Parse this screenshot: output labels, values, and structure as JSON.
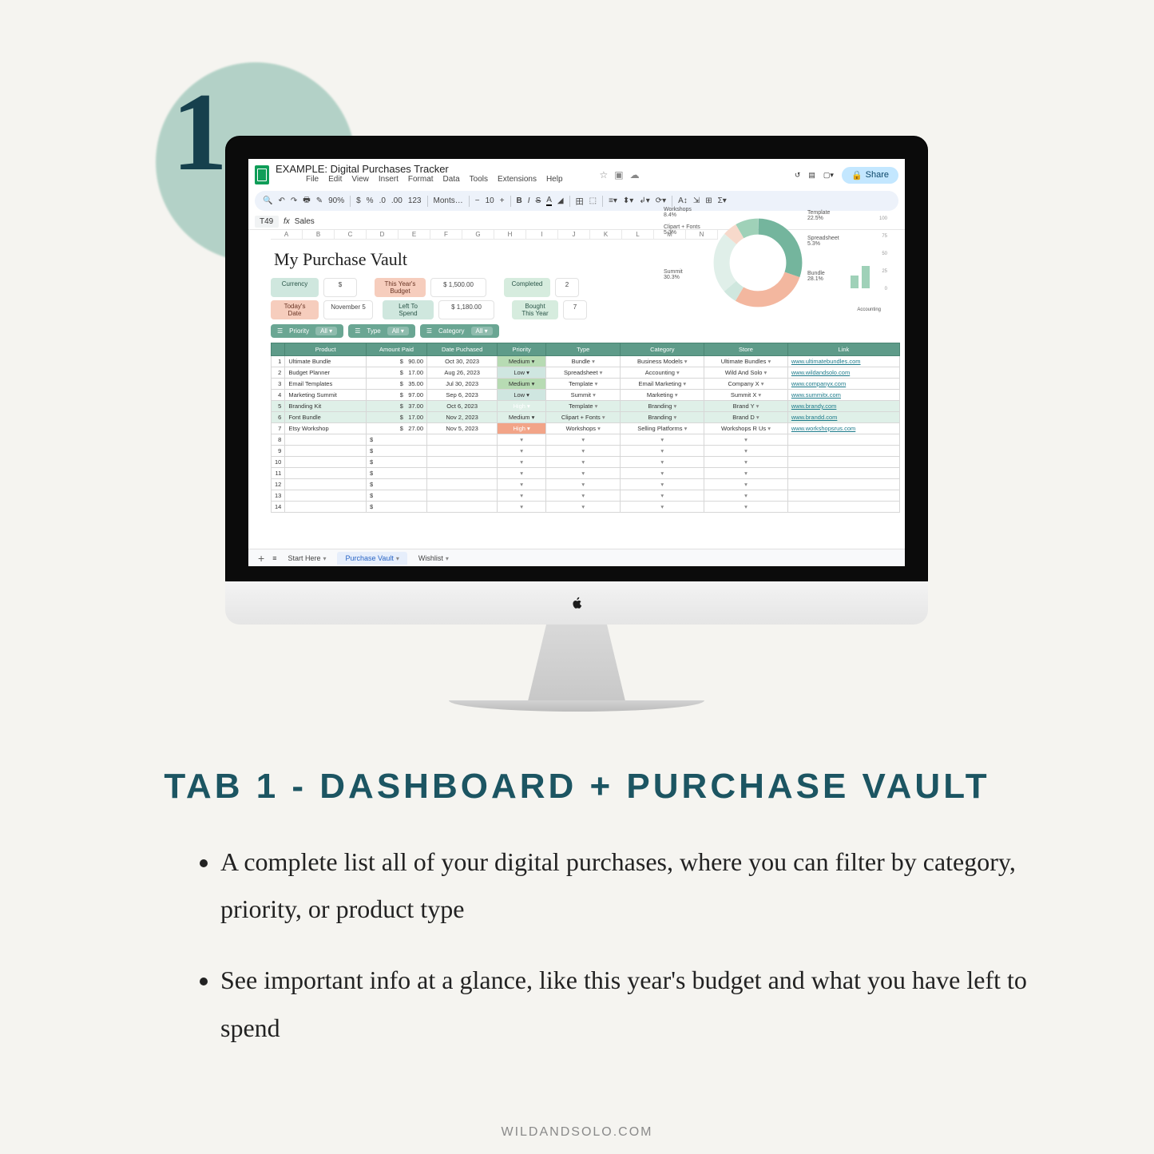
{
  "promo": {
    "number": "1.",
    "headline": "TAB 1 - DASHBOARD + PURCHASE VAULT",
    "bullet1": "A complete list all of your digital purchases, where you can filter by category, priority, or product type",
    "bullet2": "See important info at a glance, like this year's budget and what you have left to spend",
    "footer": "WILDANDSOLO.COM"
  },
  "sheets": {
    "doc_title": "EXAMPLE: Digital Purchases Tracker",
    "menu": [
      "File",
      "Edit",
      "View",
      "Insert",
      "Format",
      "Data",
      "Tools",
      "Extensions",
      "Help"
    ],
    "share": "Share",
    "toolbar": {
      "zoom": "90%",
      "font": "Monts…",
      "size": "10",
      "undo": "↶",
      "redo": "↷"
    },
    "cell_ref": "T49",
    "formula": "Sales",
    "vault_title": "My Purchase Vault",
    "info": {
      "currency_label": "Currency",
      "currency_value": "$",
      "date_label": "Today's Date",
      "date_value": "November 5",
      "budget_label": "This Year's Budget",
      "budget_value": "$    1,500.00",
      "left_label": "Left To Spend",
      "left_value": "$    1,180.00",
      "completed_label": "Completed",
      "completed_value": "2",
      "bought_label": "Bought This Year",
      "bought_value": "7"
    },
    "filters": {
      "priority": "Priority",
      "type": "Type",
      "category": "Category",
      "all": "All ▾"
    },
    "columns": [
      "",
      "Product",
      "Amount Paid",
      "Date Puchased",
      "Priority",
      "Type",
      "Category",
      "Store",
      "Link"
    ],
    "rows": [
      {
        "n": "1",
        "product": "Ultimate Bundle",
        "amt": "90.00",
        "date": "Oct 30, 2023",
        "pri": "Medium",
        "pricls": "pri-med",
        "type": "Bundle",
        "cat": "Business Models",
        "store": "Ultimate Bundles",
        "link": "www.ultimatebundles.com"
      },
      {
        "n": "2",
        "product": "Budget Planner",
        "amt": "17.00",
        "date": "Aug 26, 2023",
        "pri": "Low",
        "pricls": "pri-low",
        "type": "Spreadsheet",
        "cat": "Accounting",
        "store": "Wild And Solo",
        "link": "www.wildandsolo.com"
      },
      {
        "n": "3",
        "product": "Email Templates",
        "amt": "35.00",
        "date": "Jul 30, 2023",
        "pri": "Medium",
        "pricls": "pri-med",
        "type": "Template",
        "cat": "Email Marketing",
        "store": "Company X",
        "link": "www.companyx.com"
      },
      {
        "n": "4",
        "product": "Marketing Summit",
        "amt": "97.00",
        "date": "Sep 6, 2023",
        "pri": "Low",
        "pricls": "pri-low",
        "type": "Summit",
        "cat": "Marketing",
        "store": "Summit X",
        "link": "www.summitx.com"
      },
      {
        "n": "5",
        "product": "Branding Kit",
        "amt": "37.00",
        "date": "Oct 6, 2023",
        "pri": "High",
        "pricls": "pri-high",
        "type": "Template",
        "cat": "Branding",
        "store": "Brand Y",
        "link": "www.brandy.com",
        "sel": true
      },
      {
        "n": "6",
        "product": "Font Bundle",
        "amt": "17.00",
        "date": "Nov 2, 2023",
        "pri": "Medium",
        "pricls": "pri-med",
        "type": "Clipart + Fonts",
        "cat": "Branding",
        "store": "Brand D",
        "link": "www.brandd.com",
        "sel": true
      },
      {
        "n": "7",
        "product": "Etsy Workshop",
        "amt": "27.00",
        "date": "Nov 5, 2023",
        "pri": "High",
        "pricls": "pri-high",
        "type": "Workshops",
        "cat": "Selling Platforms",
        "store": "Workshops R Us",
        "link": "www.workshopsrus.com"
      }
    ],
    "empty_rows": [
      "8",
      "9",
      "10",
      "11",
      "12",
      "13",
      "14"
    ],
    "col_letters": [
      "A",
      "B",
      "C",
      "D",
      "E",
      "F",
      "G",
      "H",
      "I",
      "J",
      "K",
      "L",
      "M",
      "N"
    ],
    "tabs": {
      "start": "Start Here",
      "vault": "Purchase Vault",
      "wishlist": "Wishlist"
    }
  },
  "chart_data": {
    "type": "pie",
    "title": "",
    "series": [
      {
        "name": "Workshops",
        "value": 8.4
      },
      {
        "name": "Clipart + Fonts",
        "value": 5.3
      },
      {
        "name": "Template",
        "value": 22.5
      },
      {
        "name": "Spreadsheet",
        "value": 5.3
      },
      {
        "name": "Bundle",
        "value": 28.1
      },
      {
        "name": "Summit",
        "value": 30.3
      }
    ],
    "bar_axis": [
      100.0,
      75.0,
      50.0,
      25.0,
      0.0
    ],
    "bar_label": "Accounting"
  }
}
